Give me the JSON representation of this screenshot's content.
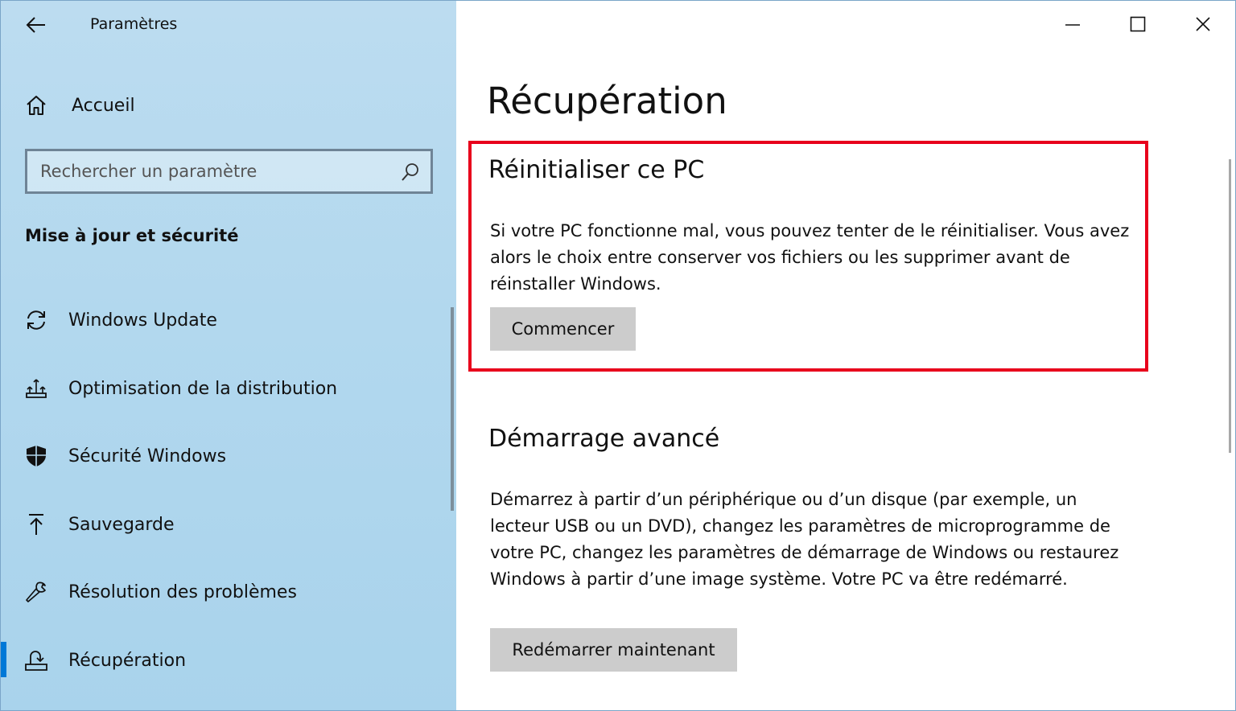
{
  "window": {
    "app_title": "Paramètres"
  },
  "sidebar": {
    "home_label": "Accueil",
    "search": {
      "placeholder": "Rechercher un paramètre"
    },
    "section_heading": "Mise à jour et sécurité",
    "items": [
      {
        "label": "Windows Update",
        "icon": "sync-icon"
      },
      {
        "label": "Optimisation de la distribution",
        "icon": "delivery-optimization-icon"
      },
      {
        "label": "Sécurité Windows",
        "icon": "shield-icon"
      },
      {
        "label": "Sauvegarde",
        "icon": "upload-arrow-icon"
      },
      {
        "label": "Résolution des problèmes",
        "icon": "wrench-icon"
      },
      {
        "label": "Récupération",
        "icon": "recovery-icon",
        "selected": true
      }
    ]
  },
  "main": {
    "title": "Récupération",
    "reset": {
      "heading": "Réinitialiser ce PC",
      "description": "Si votre PC fonctionne mal, vous pouvez tenter de le réinitialiser. Vous avez alors le choix entre conserver vos fichiers ou les supprimer avant de réinstaller Windows.",
      "button": "Commencer"
    },
    "advanced": {
      "heading": "Démarrage avancé",
      "description": "Démarrez à partir d’un périphérique ou d’un disque (par exemple, un lecteur USB ou un DVD), changez les paramètres de microprogramme de votre PC, changez les paramètres de démarrage de Windows ou restaurez Windows à partir d’une image système. Votre PC va être redémarré.",
      "button": "Redémarrer maintenant"
    }
  },
  "colors": {
    "sidebar_bg": "#b2d8ee",
    "accent": "#0078d7",
    "highlight": "#e8001c",
    "button_bg": "#cccccc"
  }
}
